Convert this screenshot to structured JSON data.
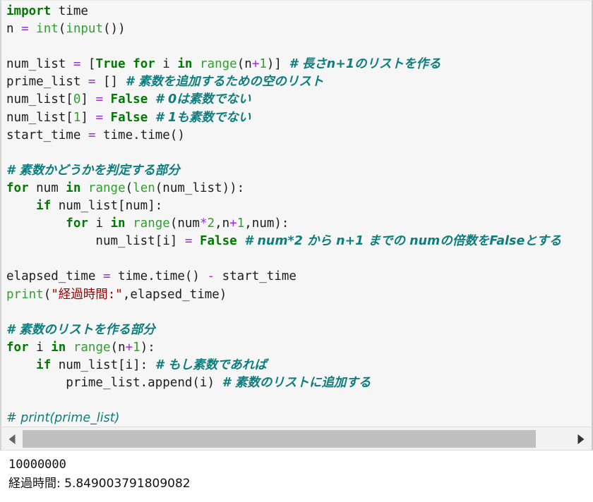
{
  "editor": {
    "language": "python",
    "background_color": "#f6f6f6",
    "colors": {
      "keyword": "#007a00",
      "builtin": "#30a030",
      "operator": "#9b30d0",
      "string": "#9c0000",
      "comment": "#0d7d7d",
      "number": "#30a030",
      "plain": "#1d1d1d"
    },
    "lines": [
      {
        "n": 1,
        "tokens": [
          {
            "t": "import",
            "c": "kw"
          },
          {
            "t": " time",
            "c": "pl"
          }
        ]
      },
      {
        "n": 2,
        "tokens": [
          {
            "t": "n ",
            "c": "pl"
          },
          {
            "t": "=",
            "c": "op"
          },
          {
            "t": " ",
            "c": "pl"
          },
          {
            "t": "int",
            "c": "bi"
          },
          {
            "t": "(",
            "c": "pl"
          },
          {
            "t": "input",
            "c": "bi"
          },
          {
            "t": "())",
            "c": "pl"
          }
        ]
      },
      {
        "n": 3,
        "tokens": []
      },
      {
        "n": 4,
        "tokens": [
          {
            "t": "num_list ",
            "c": "pl"
          },
          {
            "t": "=",
            "c": "op"
          },
          {
            "t": " [",
            "c": "pl"
          },
          {
            "t": "True",
            "c": "kw"
          },
          {
            "t": " ",
            "c": "pl"
          },
          {
            "t": "for",
            "c": "kw"
          },
          {
            "t": " i ",
            "c": "pl"
          },
          {
            "t": "in",
            "c": "kw"
          },
          {
            "t": " ",
            "c": "pl"
          },
          {
            "t": "range",
            "c": "bi"
          },
          {
            "t": "(n",
            "c": "pl"
          },
          {
            "t": "+",
            "c": "op"
          },
          {
            "t": "1",
            "c": "num"
          },
          {
            "t": ")] ",
            "c": "pl"
          },
          {
            "t": "# 長さn+1のリストを作る",
            "c": "cmt"
          }
        ]
      },
      {
        "n": 5,
        "tokens": [
          {
            "t": "prime_list ",
            "c": "pl"
          },
          {
            "t": "=",
            "c": "op"
          },
          {
            "t": " [] ",
            "c": "pl"
          },
          {
            "t": "# 素数を追加するための空のリスト",
            "c": "cmt"
          }
        ]
      },
      {
        "n": 6,
        "tokens": [
          {
            "t": "num_list[",
            "c": "pl"
          },
          {
            "t": "0",
            "c": "num"
          },
          {
            "t": "] ",
            "c": "pl"
          },
          {
            "t": "=",
            "c": "op"
          },
          {
            "t": " ",
            "c": "pl"
          },
          {
            "t": "False",
            "c": "kw"
          },
          {
            "t": " ",
            "c": "pl"
          },
          {
            "t": "# 0は素数でない",
            "c": "cmt"
          }
        ]
      },
      {
        "n": 7,
        "tokens": [
          {
            "t": "num_list[",
            "c": "pl"
          },
          {
            "t": "1",
            "c": "num"
          },
          {
            "t": "] ",
            "c": "pl"
          },
          {
            "t": "=",
            "c": "op"
          },
          {
            "t": " ",
            "c": "pl"
          },
          {
            "t": "False",
            "c": "kw"
          },
          {
            "t": " ",
            "c": "pl"
          },
          {
            "t": "# 1も素数でない",
            "c": "cmt"
          }
        ]
      },
      {
        "n": 8,
        "tokens": [
          {
            "t": "start_time ",
            "c": "pl"
          },
          {
            "t": "=",
            "c": "op"
          },
          {
            "t": " time.time()",
            "c": "pl"
          }
        ]
      },
      {
        "n": 9,
        "tokens": []
      },
      {
        "n": 10,
        "tokens": [
          {
            "t": "# 素数かどうかを判定する部分",
            "c": "cmt"
          }
        ]
      },
      {
        "n": 11,
        "tokens": [
          {
            "t": "for",
            "c": "kw"
          },
          {
            "t": " num ",
            "c": "pl"
          },
          {
            "t": "in",
            "c": "kw"
          },
          {
            "t": " ",
            "c": "pl"
          },
          {
            "t": "range",
            "c": "bi"
          },
          {
            "t": "(",
            "c": "pl"
          },
          {
            "t": "len",
            "c": "bi"
          },
          {
            "t": "(num_list)):",
            "c": "pl"
          }
        ]
      },
      {
        "n": 12,
        "tokens": [
          {
            "t": "    ",
            "c": "pl"
          },
          {
            "t": "if",
            "c": "kw"
          },
          {
            "t": " num_list[num]:",
            "c": "pl"
          }
        ]
      },
      {
        "n": 13,
        "tokens": [
          {
            "t": "        ",
            "c": "pl"
          },
          {
            "t": "for",
            "c": "kw"
          },
          {
            "t": " i ",
            "c": "pl"
          },
          {
            "t": "in",
            "c": "kw"
          },
          {
            "t": " ",
            "c": "pl"
          },
          {
            "t": "range",
            "c": "bi"
          },
          {
            "t": "(num",
            "c": "pl"
          },
          {
            "t": "*",
            "c": "op"
          },
          {
            "t": "2",
            "c": "num"
          },
          {
            "t": ",n",
            "c": "pl"
          },
          {
            "t": "+",
            "c": "op"
          },
          {
            "t": "1",
            "c": "num"
          },
          {
            "t": ",num):",
            "c": "pl"
          }
        ]
      },
      {
        "n": 14,
        "tokens": [
          {
            "t": "            num_list[i] ",
            "c": "pl"
          },
          {
            "t": "=",
            "c": "op"
          },
          {
            "t": " ",
            "c": "pl"
          },
          {
            "t": "False",
            "c": "kw"
          },
          {
            "t": " ",
            "c": "pl"
          },
          {
            "t": "# num*2 から n+1 までの numの倍数をFalseとする",
            "c": "cmt"
          }
        ]
      },
      {
        "n": 15,
        "tokens": []
      },
      {
        "n": 16,
        "tokens": [
          {
            "t": "elapsed_time ",
            "c": "pl"
          },
          {
            "t": "=",
            "c": "op"
          },
          {
            "t": " time.time() ",
            "c": "pl"
          },
          {
            "t": "-",
            "c": "op"
          },
          {
            "t": " start_time",
            "c": "pl"
          }
        ]
      },
      {
        "n": 17,
        "tokens": [
          {
            "t": "print",
            "c": "bi"
          },
          {
            "t": "(",
            "c": "pl"
          },
          {
            "t": "\"経過時間:\"",
            "c": "str"
          },
          {
            "t": ",elapsed_time)",
            "c": "pl"
          }
        ]
      },
      {
        "n": 18,
        "tokens": []
      },
      {
        "n": 19,
        "tokens": [
          {
            "t": "# 素数のリストを作る部分",
            "c": "cmt"
          }
        ]
      },
      {
        "n": 20,
        "tokens": [
          {
            "t": "for",
            "c": "kw"
          },
          {
            "t": " i ",
            "c": "pl"
          },
          {
            "t": "in",
            "c": "kw"
          },
          {
            "t": " ",
            "c": "pl"
          },
          {
            "t": "range",
            "c": "bi"
          },
          {
            "t": "(n",
            "c": "pl"
          },
          {
            "t": "+",
            "c": "op"
          },
          {
            "t": "1",
            "c": "num"
          },
          {
            "t": "):",
            "c": "pl"
          }
        ]
      },
      {
        "n": 21,
        "tokens": [
          {
            "t": "    ",
            "c": "pl"
          },
          {
            "t": "if",
            "c": "kw"
          },
          {
            "t": " num_list[i]: ",
            "c": "pl"
          },
          {
            "t": "# もし素数であれば",
            "c": "cmt"
          }
        ]
      },
      {
        "n": 22,
        "tokens": [
          {
            "t": "        prime_list.append(i) ",
            "c": "pl"
          },
          {
            "t": "# 素数のリストに追加する",
            "c": "cmt"
          }
        ]
      },
      {
        "n": 23,
        "tokens": []
      },
      {
        "n": 24,
        "tokens": [
          {
            "t": "# print(prime_list)",
            "c": "cmt-l"
          }
        ]
      }
    ]
  },
  "scrollbar": {
    "left_arrow_icon": "triangle-left-icon",
    "right_arrow_icon": "triangle-right-icon",
    "thumb_color": "#c0c0c0",
    "track_color": "#f2f2f2"
  },
  "output": {
    "lines": [
      "10000000",
      "経過時間: 5.849003791809082"
    ]
  }
}
